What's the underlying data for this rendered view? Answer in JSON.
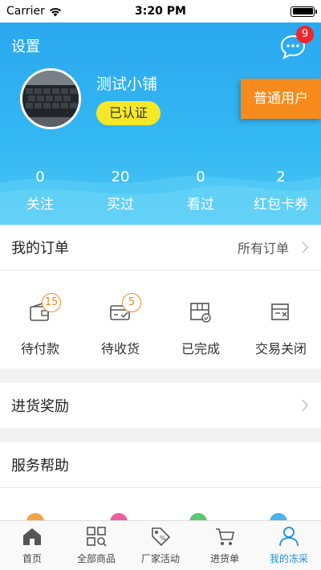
{
  "status_bar": {
    "carrier": "Carrier",
    "time": "3:20 PM",
    "battery_level": 1.0
  },
  "header": {
    "settings_label": "设置",
    "message_badge": "9",
    "shop_name": "测试小铺",
    "verified_label": "已认证",
    "user_type": "普通用户",
    "stats": [
      {
        "value": "0",
        "label": "关注"
      },
      {
        "value": "20",
        "label": "买过"
      },
      {
        "value": "0",
        "label": "看过"
      },
      {
        "value": "2",
        "label": "红包卡券"
      }
    ]
  },
  "orders": {
    "title": "我的订单",
    "all_label": "所有订单",
    "items": [
      {
        "label": "待付款",
        "badge": "15",
        "icon": "wallet-icon"
      },
      {
        "label": "待收货",
        "badge": "5",
        "icon": "card-receive-icon"
      },
      {
        "label": "已完成",
        "badge": "",
        "icon": "box-check-icon"
      },
      {
        "label": "交易关闭",
        "badge": "",
        "icon": "closed-box-icon"
      }
    ]
  },
  "reward": {
    "title": "进货奖励"
  },
  "service": {
    "title": "服务帮助"
  },
  "tabbar": {
    "active_color": "#1a8fe0",
    "items": [
      {
        "label": "首页",
        "icon": "home-icon"
      },
      {
        "label": "全部商品",
        "icon": "grid-icon"
      },
      {
        "label": "厂家活动",
        "icon": "tag-icon"
      },
      {
        "label": "进货单",
        "icon": "cart-icon"
      },
      {
        "label": "我的冻采",
        "icon": "user-icon"
      }
    ]
  }
}
